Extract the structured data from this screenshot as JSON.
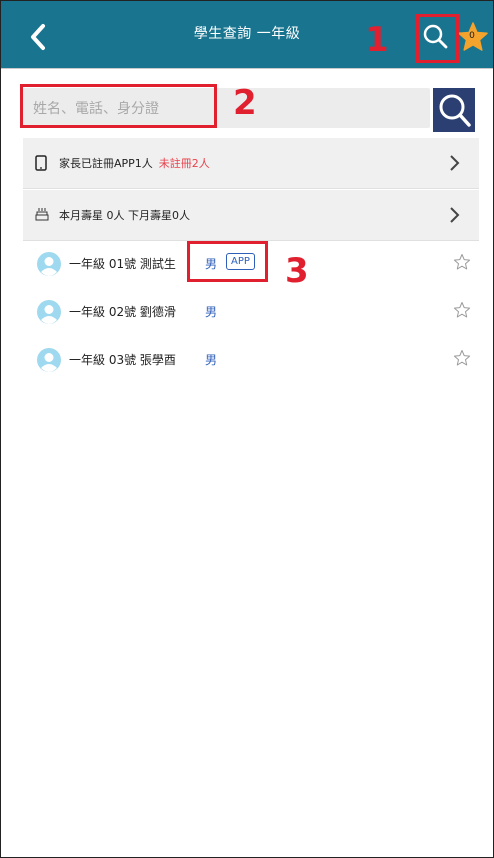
{
  "header": {
    "title": "學生查詢 一年級",
    "star_count": "0"
  },
  "search": {
    "placeholder": "姓名、電話、身分證"
  },
  "info": {
    "app_registered": "家長已註冊APP1人",
    "app_unregistered": "未註冊2人",
    "birthday": "本月壽星 0人 下月壽星0人"
  },
  "students": [
    {
      "name": "一年級 01號 測試生",
      "gender": "男",
      "badge": "APP"
    },
    {
      "name": "一年級 02號 劉德滑",
      "gender": "男"
    },
    {
      "name": "一年級 03號 張學酉",
      "gender": "男"
    }
  ],
  "annotations": [
    "1",
    "2",
    "3"
  ],
  "colors": {
    "header_bg": "#19748f",
    "search_button_bg": "#2b3f72",
    "accent_red": "#e0202f",
    "gender_blue": "#2f5fb8",
    "star_orange": "#f4a32c"
  },
  "icons": [
    "back-chevron-icon",
    "search-icon",
    "star-icon",
    "phone-icon",
    "cake-icon",
    "chevron-right-icon",
    "avatar-icon",
    "star-outline-icon"
  ]
}
